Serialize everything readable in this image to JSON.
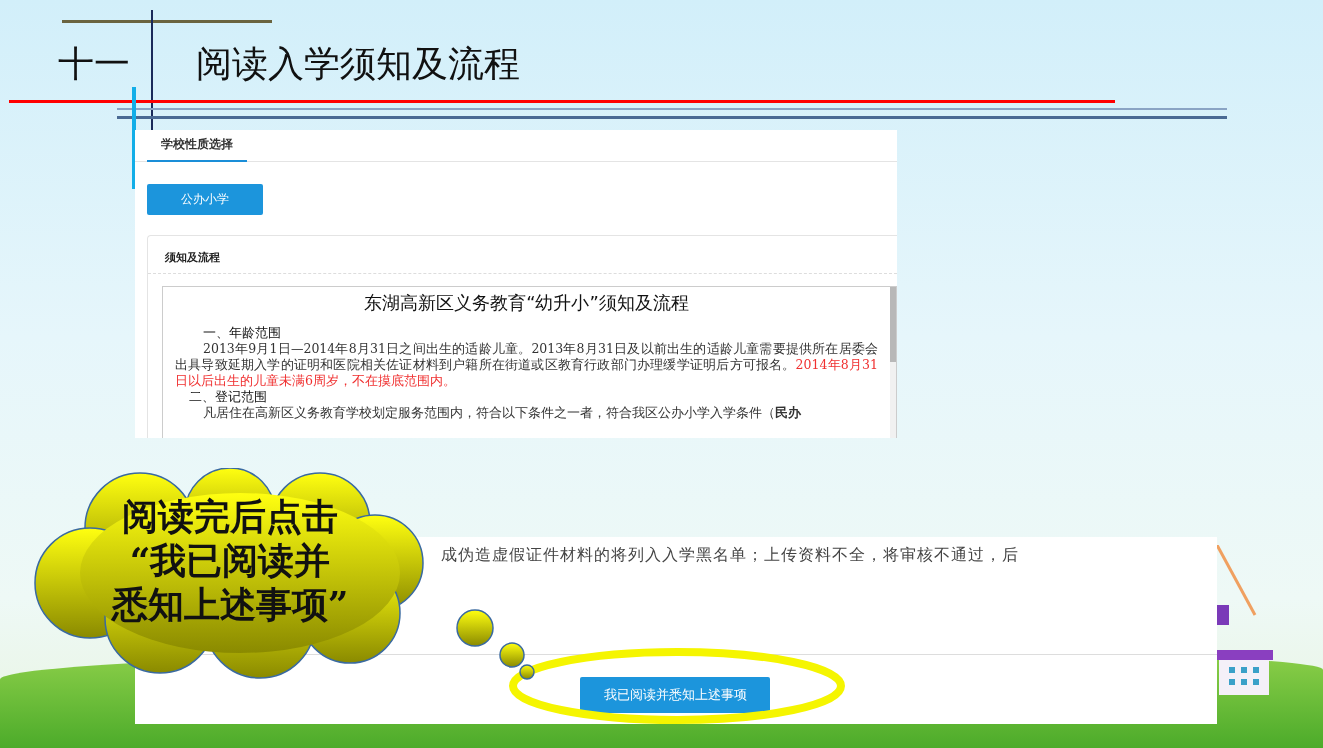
{
  "slide": {
    "number": "十一",
    "title": "阅读入学须知及流程"
  },
  "screenshot_top": {
    "tab": {
      "label": "学校性质选择",
      "selected": true
    },
    "school_type_button": "公办小学",
    "section_title": "须知及流程",
    "document": {
      "heading": "东湖高新区义务教育“幼升小”须知及流程",
      "paragraphs": [
        {
          "kind": "heading",
          "segments": [
            {
              "text": "一、年龄范围",
              "highlight": false
            }
          ]
        },
        {
          "kind": "body",
          "segments": [
            {
              "text": "2013年9月1日—2014年8月31日之间出生的适龄儿童。2013年8月31日及以前出生的适龄儿童需要提供所在居委会出具导致延期入学的证明和医院相关佐证材料到户籍所在街道或区教育行政部门办理缓学证明后方可报名。",
              "highlight": false
            },
            {
              "text": "2014年8月31日以后出生的儿童未满6周岁，不在摸底范围内。",
              "highlight": true
            }
          ]
        },
        {
          "kind": "subheading",
          "segments": [
            {
              "text": "二、登记范围",
              "highlight": false
            }
          ]
        },
        {
          "kind": "body",
          "segments": [
            {
              "text": "凡居住在高新区义务教育学校划定服务范围内，符合以下条件之一者，符合我区公办小学入学条件（**民办**",
              "highlight": false
            }
          ]
        }
      ]
    }
  },
  "screenshot_bottom": {
    "notice_line": "成伪造虚假证件材料的将列入入学黑名单；上传资料不全，将审核不通过，后",
    "confirm_button": "我已阅读并悉知上述事项"
  },
  "callout": {
    "lines": [
      "阅读完后点击",
      "“我已阅读并",
      "悉知上述事项”"
    ]
  }
}
